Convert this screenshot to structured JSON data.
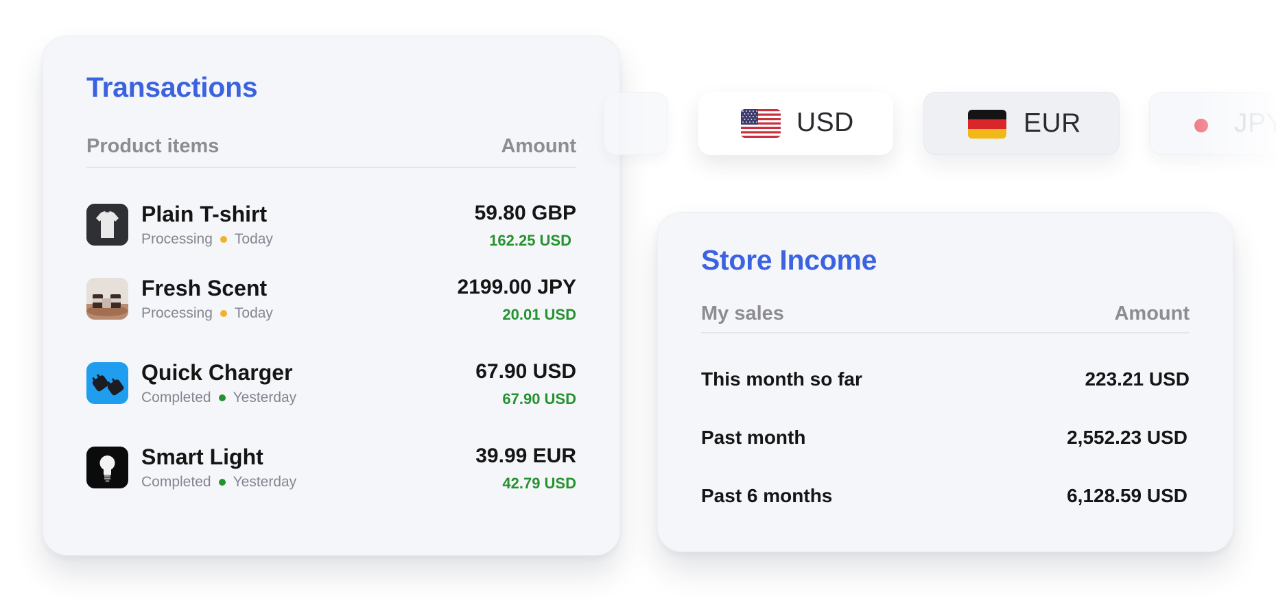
{
  "transactions": {
    "title": "Transactions",
    "col_product": "Product items",
    "col_amount": "Amount",
    "items": [
      {
        "name": "Plain T-shirt",
        "status": "Processing",
        "when": "Today",
        "amount": "59.80 GBP",
        "usd": "162.25 USD",
        "status_color": "#f0b12c",
        "thumb": "tshirt-icon"
      },
      {
        "name": "Fresh Scent",
        "status": "Processing",
        "when": "Today",
        "amount": "2199.00 JPY",
        "usd": "20.01 USD",
        "status_color": "#f0b12c",
        "thumb": "candles-icon"
      },
      {
        "name": "Quick Charger",
        "status": "Completed",
        "when": "Yesterday",
        "amount": "67.90 USD",
        "usd": "67.90 USD",
        "status_color": "#24922f",
        "thumb": "charger-icon"
      },
      {
        "name": "Smart Light",
        "status": "Completed",
        "when": "Yesterday",
        "amount": "39.99 EUR",
        "usd": "42.79 USD",
        "status_color": "#24922f",
        "thumb": "lightbulb-icon"
      }
    ]
  },
  "currencies": [
    {
      "code": "USD",
      "flag": "us-flag-icon"
    },
    {
      "code": "EUR",
      "flag": "de-flag-icon"
    },
    {
      "code": "JPY",
      "flag": "jp-flag-icon"
    }
  ],
  "income": {
    "title": "Store Income",
    "col_label": "My sales",
    "col_amount": "Amount",
    "rows": [
      {
        "label": "This month so far",
        "value": "223.21 USD"
      },
      {
        "label": "Past month",
        "value": "2,552.23 USD"
      },
      {
        "label": "Past 6 months",
        "value": "6,128.59 USD"
      }
    ]
  },
  "colors": {
    "accent": "#3b63e0",
    "positive": "#24922f",
    "pending": "#f0b12c"
  }
}
